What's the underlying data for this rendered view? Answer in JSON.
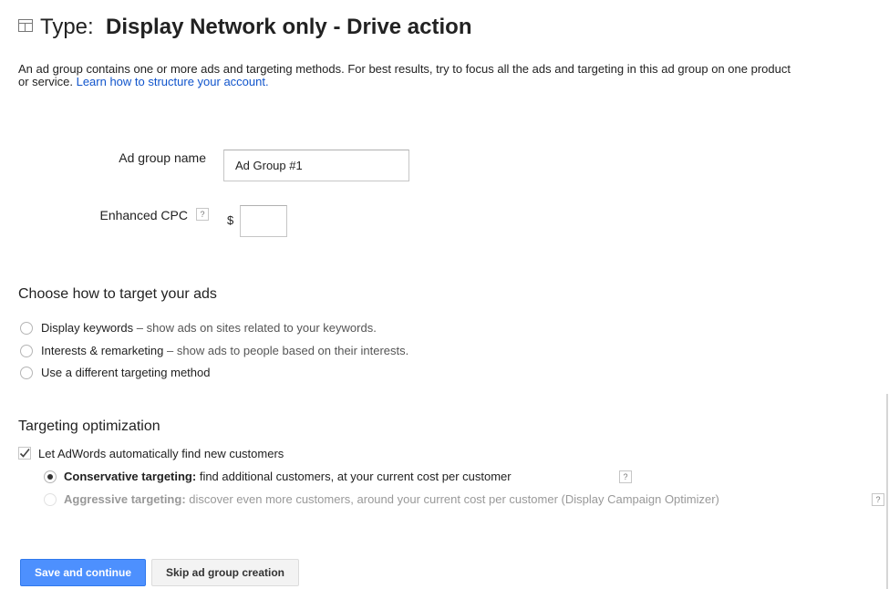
{
  "header": {
    "type_label": "Type:",
    "type_value": "Display Network only - Drive action"
  },
  "intro": {
    "text": "An ad group contains one or more ads and targeting methods. For best results, try to focus all the ads and targeting in this ad group on one product or service.",
    "link": "Learn how to structure your account."
  },
  "form": {
    "ad_group_name_label": "Ad group name",
    "ad_group_name_value": "Ad Group #1",
    "enhanced_cpc_label": "Enhanced CPC",
    "currency_symbol": "$",
    "enhanced_cpc_value": "",
    "help_glyph": "?"
  },
  "targeting": {
    "title": "Choose how to target your ads",
    "options": [
      {
        "label": "Display keywords",
        "desc": "show ads on sites related to your keywords.",
        "checked": false
      },
      {
        "label": "Interests & remarketing",
        "desc": "show ads to people based on their interests.",
        "checked": false
      },
      {
        "label": "Use a different targeting method",
        "desc": "",
        "checked": false
      }
    ],
    "dash": "–"
  },
  "optimization": {
    "title": "Targeting optimization",
    "checkbox_label": "Let AdWords automatically find new customers",
    "checkbox_checked": true,
    "conservative_label": "Conservative targeting:",
    "conservative_desc": "find additional customers, at your current cost per customer",
    "conservative_checked": true,
    "aggressive_label": "Aggressive targeting:",
    "aggressive_desc": "discover even more customers, around your current cost per customer (Display Campaign Optimizer)",
    "aggressive_enabled": false
  },
  "buttons": {
    "save": "Save and continue",
    "skip": "Skip ad group creation"
  },
  "colors": {
    "link": "#1155cc",
    "primary_button": "#4d90fe",
    "secondary_button": "#f3f3f3"
  }
}
